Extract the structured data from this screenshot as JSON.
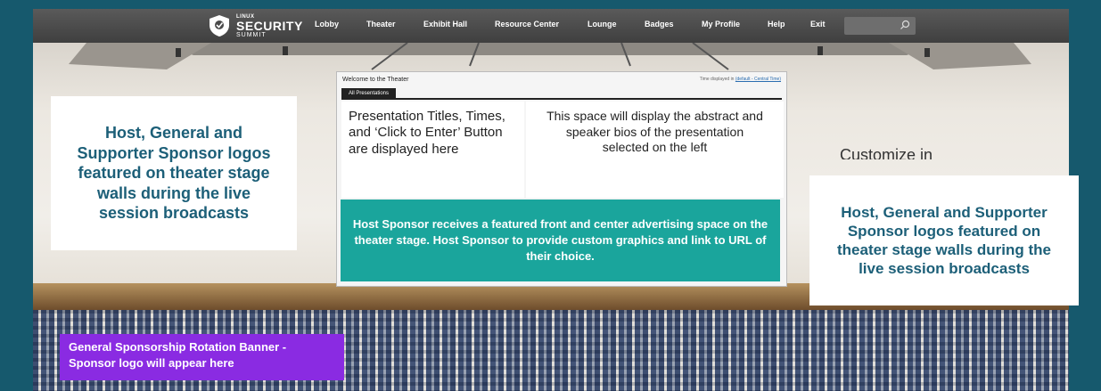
{
  "brand": {
    "logo_small": "LINUX",
    "logo_big": "SECURITY",
    "logo_sub": "SUMMIT"
  },
  "nav": {
    "items": [
      "Lobby",
      "Theater",
      "Exhibit Hall",
      "Resource Center",
      "Lounge",
      "Badges",
      "My Profile",
      "Help",
      "Exit"
    ],
    "search_placeholder": ""
  },
  "callouts": {
    "left": "Host, General and Supporter Sponsor logos featured on theater stage walls during the live session broadcasts",
    "right": "Host, General and Supporter Sponsor logos featured on theater stage walls during the live session broadcasts",
    "customize": "Customize in"
  },
  "theater_panel": {
    "title": "Welcome to the Theater",
    "tz_prefix": "Time displayed in",
    "tz_link": "(default - Central Time)",
    "tab": "All Presentations",
    "left_text": "Presentation Titles, Times, and ‘Click to Enter’ Button are displayed here",
    "right_text": "This space will display the abstract and speaker bios of the presentation selected on the left"
  },
  "host_box": "Host Sponsor receives a featured front and center advertising space on the theater stage. Host Sponsor to provide custom graphics and link to URL of their choice.",
  "rotation_banner": "General Sponsorship Rotation Banner - Sponsor logo will appear here",
  "colors": {
    "frame": "#16596d",
    "navbar": "#4a4a4a",
    "callout_text": "#1c5f78",
    "host_box": "#1aa59c",
    "banner": "#8a2be2"
  }
}
